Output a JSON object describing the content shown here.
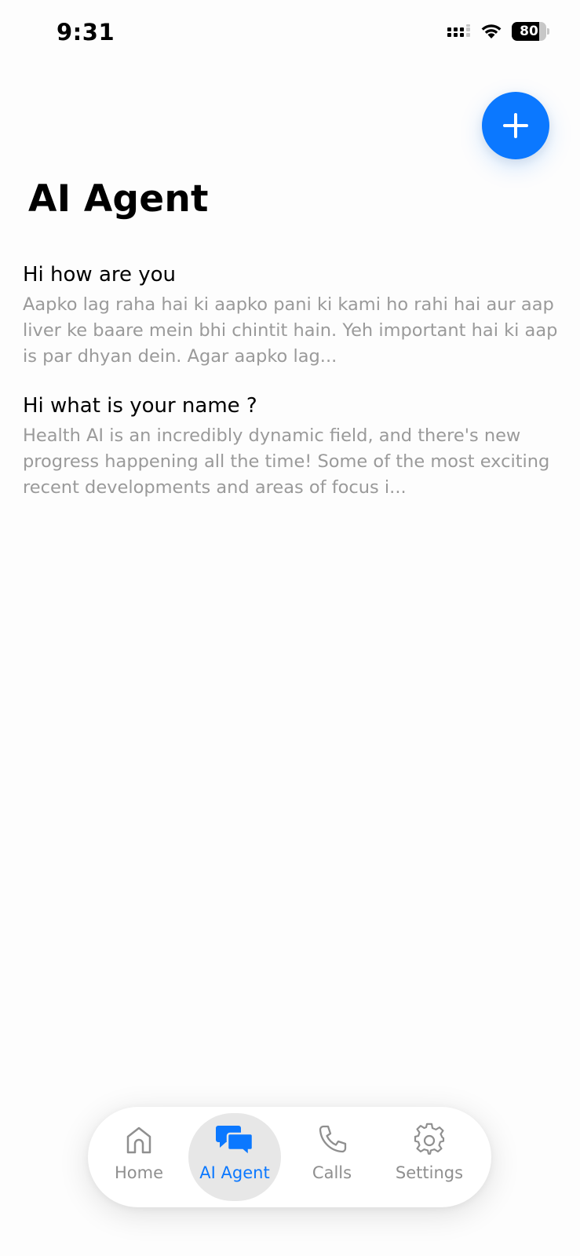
{
  "status_bar": {
    "time": "9:31",
    "battery_level": "80",
    "icons": [
      "signal-icon",
      "wifi-icon",
      "battery-icon"
    ]
  },
  "header": {
    "title": "AI Agent",
    "fab_icon": "plus-icon"
  },
  "chats": [
    {
      "title": "Hi how are you",
      "preview": "Aapko lag raha hai ki aapko pani ki kami ho rahi hai aur aap liver ke baare mein bhi chintit hain. Yeh important hai ki aap is par dhyan dein. Agar aapko lag..."
    },
    {
      "title": "Hi what is your name ?",
      "preview": "Health AI is an incredibly dynamic field, and there's new progress happening all the time! Some of the most exciting recent developments and areas of focus i..."
    }
  ],
  "nav": {
    "items": [
      {
        "label": "Home",
        "icon": "home-icon"
      },
      {
        "label": "AI Agent",
        "icon": "chat-bubbles-icon",
        "active": true
      },
      {
        "label": "Calls",
        "icon": "phone-icon"
      },
      {
        "label": "Settings",
        "icon": "gear-icon"
      }
    ]
  },
  "colors": {
    "accent": "#0b78ff",
    "preview_text": "#9a9a9a",
    "nav_inactive": "#8f8f8f",
    "active_pill": "#e7e7e7"
  }
}
